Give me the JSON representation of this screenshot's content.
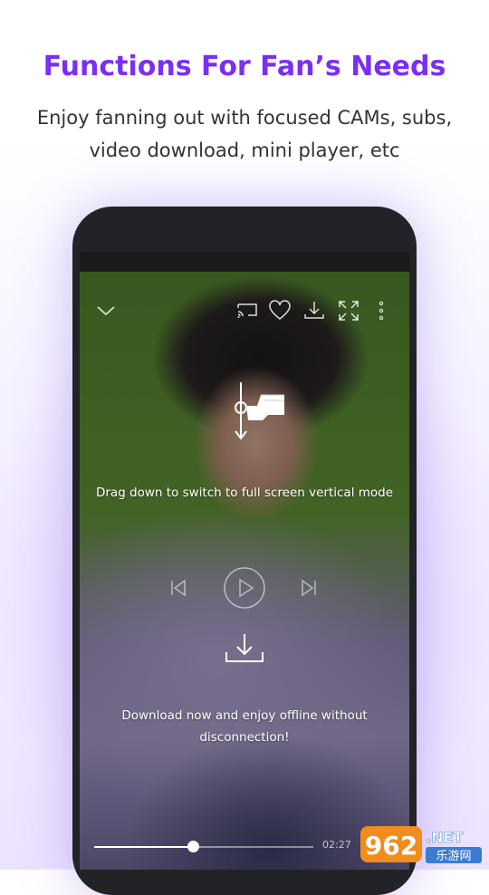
{
  "promo": {
    "headline": "Functions For Fan’s Needs",
    "subline": "Enjoy fanning out with focused CAMs, subs, video download, mini player, etc"
  },
  "player": {
    "top_icons": [
      "chevron-down-icon",
      "cast-icon",
      "heart-icon",
      "download-icon",
      "fullscreen-icon",
      "more-icon"
    ],
    "gesture_hint": "Drag down to switch to full screen vertical mode",
    "download_hint": "Download now and enjoy offline without disconnection!",
    "controls": [
      "previous-icon",
      "play-icon",
      "next-icon"
    ],
    "current_time": "02:27",
    "progress": 0.45
  },
  "watermark": {
    "number": "962",
    "suffix": ".NET",
    "chinese": "乐游网"
  },
  "colors": {
    "accent": "#7b2ff2",
    "text": "#333333",
    "phone_frame": "#222326"
  }
}
